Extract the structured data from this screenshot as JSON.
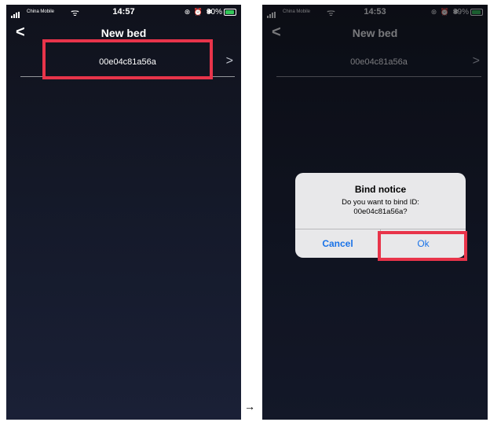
{
  "left": {
    "status": {
      "carrier": "China Mobile",
      "time": "14:57",
      "battery": "90%",
      "battery_level": 90
    },
    "nav": {
      "back": "<",
      "title": "New bed"
    },
    "device": {
      "id": "00e04c81a56a",
      "chevron": ">"
    }
  },
  "right": {
    "status": {
      "carrier": "China Mobile",
      "time": "14:53",
      "battery": "89%",
      "battery_level": 89
    },
    "nav": {
      "back": "<",
      "title": "New bed"
    },
    "device": {
      "id": "00e04c81a56a",
      "chevron": ">"
    },
    "alert": {
      "title": "Bind notice",
      "message_line1": "Do you want to bind ID:",
      "message_line2": "00e04c81a56a?",
      "cancel": "Cancel",
      "ok": "Ok"
    }
  },
  "arrow": "→",
  "colors": {
    "highlight": "#e8344a",
    "battery": "#34c759",
    "alert_button": "#1a73e8"
  }
}
